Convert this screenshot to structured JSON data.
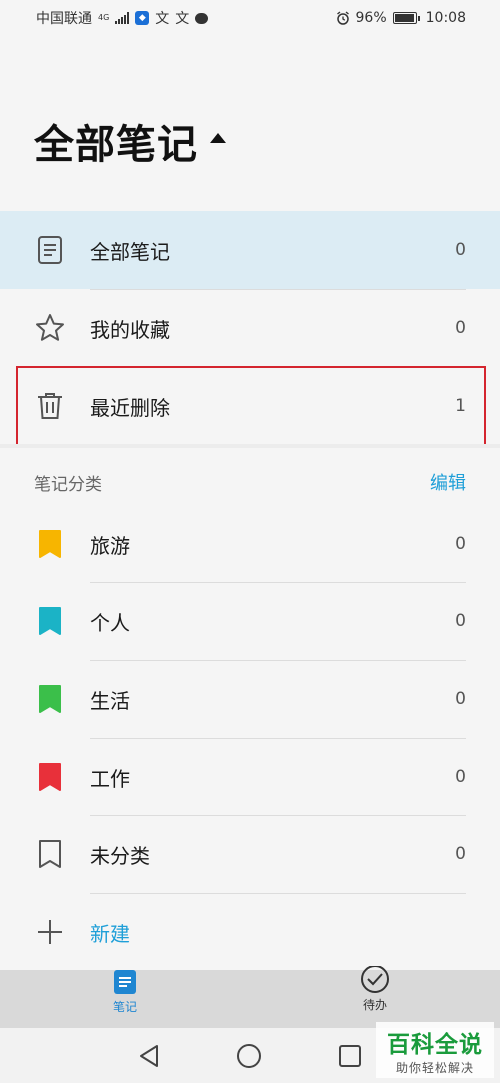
{
  "status_bar": {
    "carrier": "中国联通",
    "network": "4G",
    "ime_1": "文",
    "ime_2": "文",
    "battery": "96%",
    "time": "10:08"
  },
  "header": {
    "title": "全部笔记"
  },
  "top_items": [
    {
      "label": "全部笔记",
      "count": "0",
      "icon": "note-document-icon"
    },
    {
      "label": "我的收藏",
      "count": "0",
      "icon": "star-icon"
    },
    {
      "label": "最近删除",
      "count": "1",
      "icon": "trash-icon"
    }
  ],
  "categories_section": {
    "title": "笔记分类",
    "edit_label": "编辑"
  },
  "categories": [
    {
      "label": "旅游",
      "count": "0",
      "color": "#f7b500",
      "icon": "bookmark-yellow-icon"
    },
    {
      "label": "个人",
      "count": "0",
      "color": "#1bb3c6",
      "icon": "bookmark-teal-icon"
    },
    {
      "label": "生活",
      "count": "0",
      "color": "#3bbf4a",
      "icon": "bookmark-green-icon"
    },
    {
      "label": "工作",
      "count": "0",
      "color": "#e8303a",
      "icon": "bookmark-red-icon"
    },
    {
      "label": "未分类",
      "count": "0",
      "color": "#555555",
      "icon": "bookmark-outline-icon"
    }
  ],
  "new_item": {
    "label": "新建"
  },
  "tabs": [
    {
      "label": "笔记",
      "active": true,
      "icon": "notes-tab-icon"
    },
    {
      "label": "待办",
      "active": false,
      "icon": "todo-check-icon"
    }
  ],
  "watermark": {
    "main": "百科全说",
    "sub": "助你轻松解决"
  },
  "colors": {
    "accent": "#1f9fd8",
    "selected_bg": "#dcecf4",
    "highlight_border": "#d4252e"
  }
}
